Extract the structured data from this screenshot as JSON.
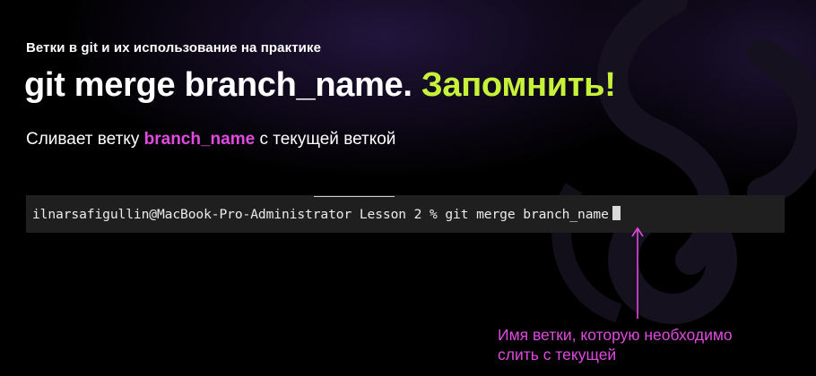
{
  "slide": {
    "subtitle": "Ветки в git и их использование на практике",
    "title_command": "git merge branch_name.",
    "title_accent": "Запомнить!",
    "description_prefix": "Сливает ветку",
    "description_branch": "branch_name",
    "description_suffix": "с текущей веткой"
  },
  "terminal": {
    "command_line": "ilnarsafigullin@MacBook-Pro-Administrator Lesson 2 % git merge branch_name"
  },
  "callout": {
    "line1": "Имя ветки, которую необходимо",
    "line2": "слить с текущей"
  },
  "colors": {
    "background": "#000000",
    "accent_green": "#c7f23a",
    "accent_magenta": "#e14be0",
    "terminal_bg": "#1f1f1f"
  }
}
